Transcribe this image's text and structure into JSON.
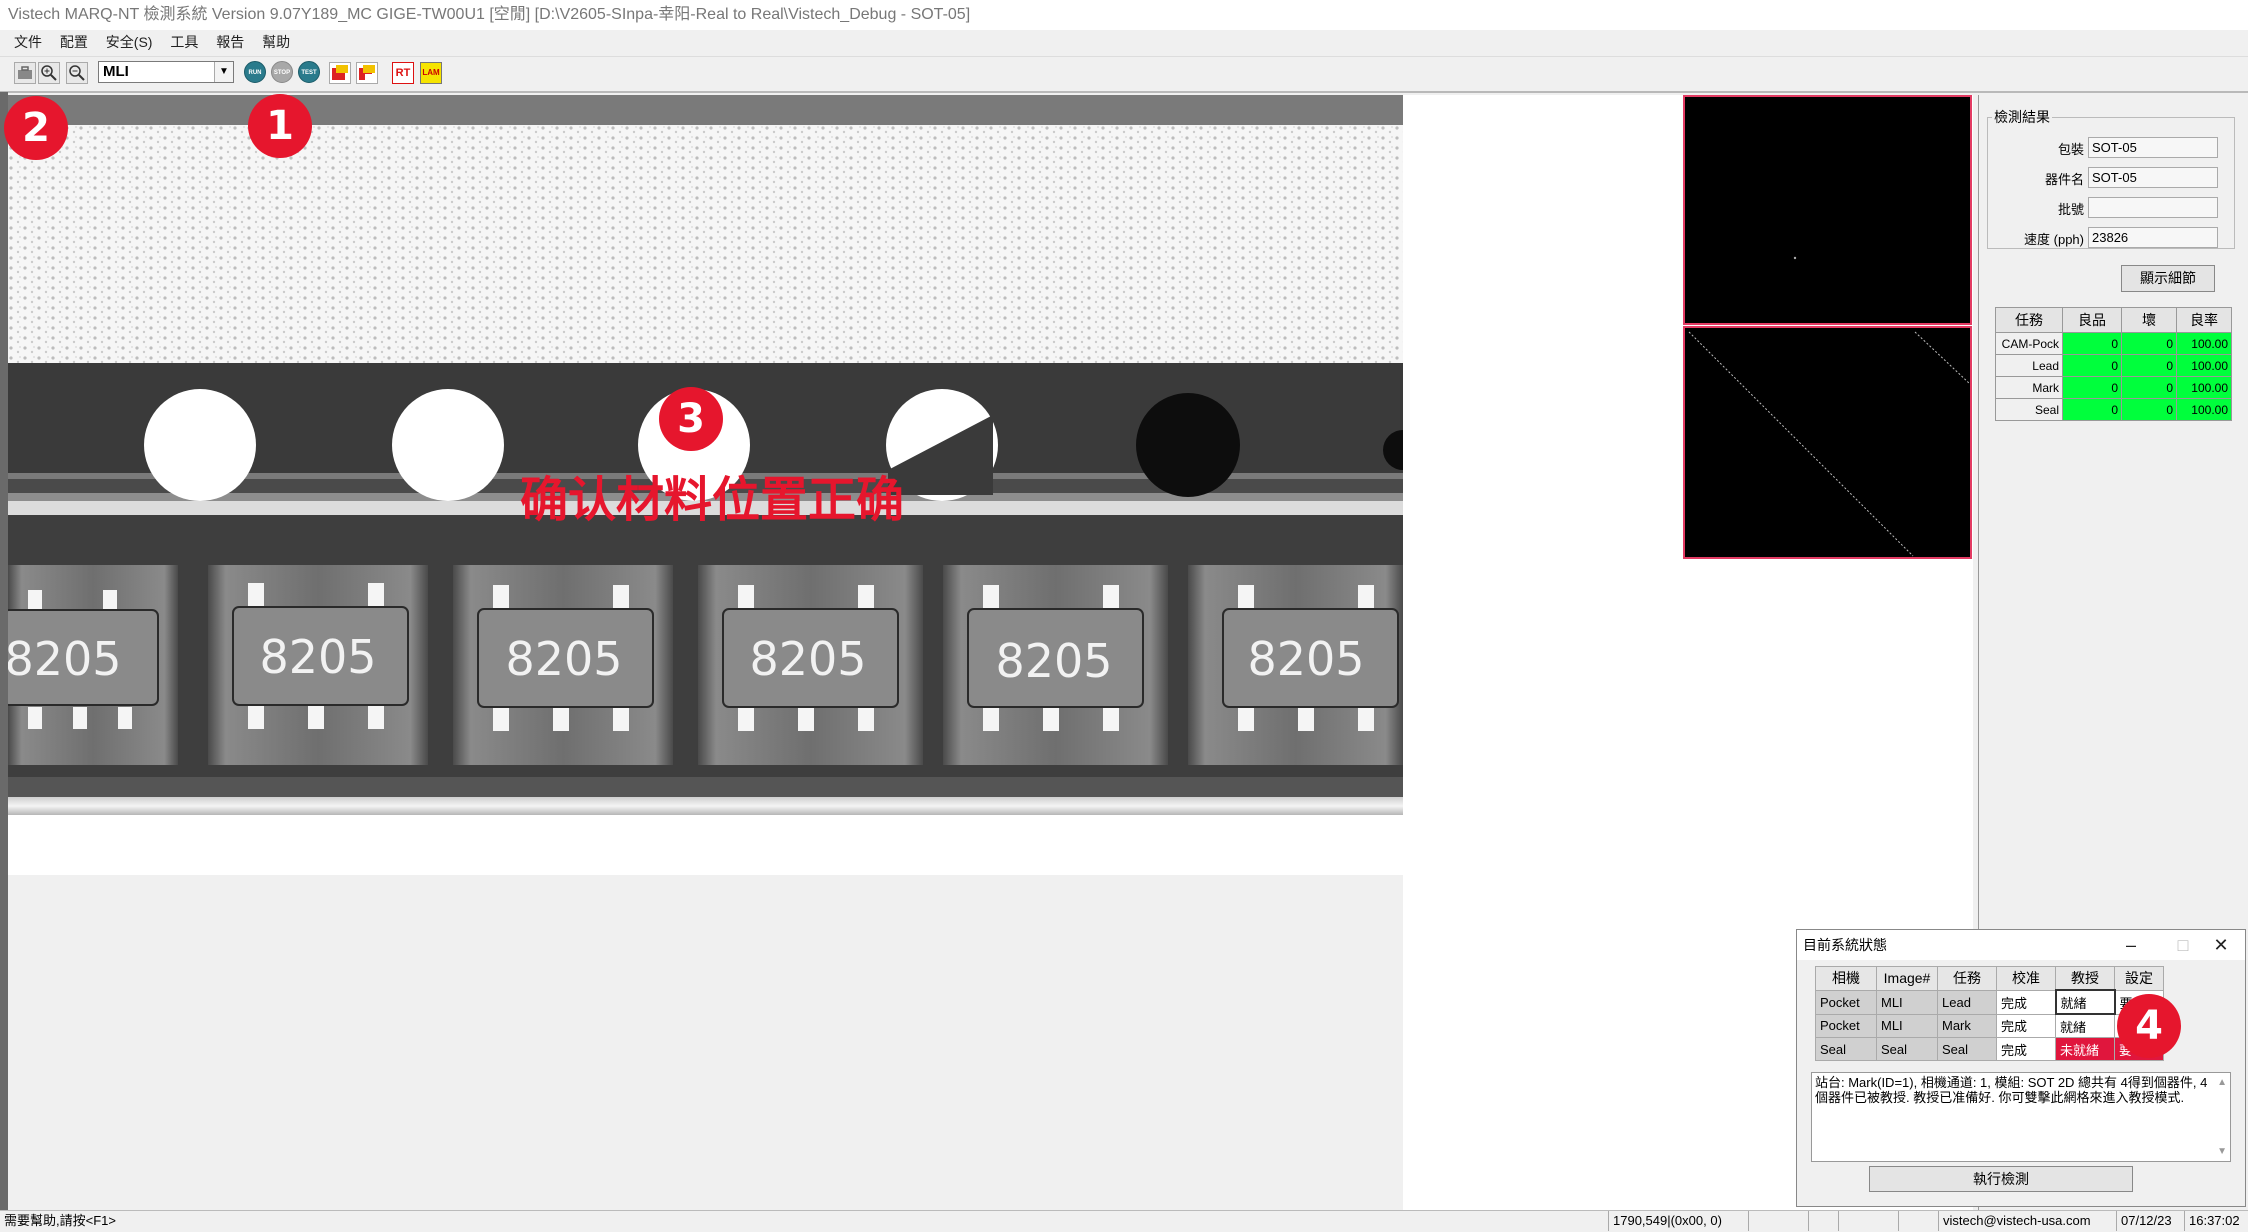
{
  "window": {
    "title": "Vistech MARQ-NT 檢測系統 Version 9.07Y189_MC GIGE-TW00U1 [空閒] [D:\\V2605-SInpa-幸阳-Real to Real\\Vistech_Debug - SOT-05]"
  },
  "menu": [
    "文件",
    "配置",
    "安全(S)",
    "工具",
    "報告",
    "幫助"
  ],
  "toolbar": {
    "camera_select": "MLI",
    "run_label": "RUN",
    "stop_label": "STOP",
    "test_label": "TEST",
    "rt_label": "RT",
    "lam_label": "LAM"
  },
  "annotations": {
    "badge1": "1",
    "badge2": "2",
    "badge3": "3",
    "badge4": "4",
    "confirm_text": "确认材料位置正确"
  },
  "component_marking": "8205",
  "results": {
    "legend": "檢測結果",
    "package_label": "包裝",
    "package_value": "SOT-05",
    "device_label": "器件名",
    "device_value": "SOT-05",
    "lot_label": "批號",
    "lot_value": "",
    "speed_label": "速度 (pph)",
    "speed_value": "23826",
    "details_button": "顯示細節"
  },
  "stats": {
    "headers": [
      "任務",
      "良品",
      "壞",
      "良率"
    ],
    "rows": [
      {
        "task": "CAM-Pock",
        "good": "0",
        "bad": "0",
        "yield": "100.00"
      },
      {
        "task": "Lead",
        "good": "0",
        "bad": "0",
        "yield": "100.00"
      },
      {
        "task": "Mark",
        "good": "0",
        "bad": "0",
        "yield": "100.00"
      },
      {
        "task": "Seal",
        "good": "0",
        "bad": "0",
        "yield": "100.00"
      }
    ]
  },
  "status_dialog": {
    "title": "目前系統狀態",
    "headers": [
      "相機",
      "Image#",
      "任務",
      "校准",
      "教授",
      "設定"
    ],
    "rows": [
      {
        "camera": "Pocket",
        "image": "MLI",
        "task": "Lead",
        "calib": "完成",
        "teach": "就緒",
        "setting": "要"
      },
      {
        "camera": "Pocket",
        "image": "MLI",
        "task": "Mark",
        "calib": "完成",
        "teach": "就緒",
        "setting": ""
      },
      {
        "camera": "Seal",
        "image": "Seal",
        "task": "Seal",
        "calib": "完成",
        "teach": "未就緒",
        "setting": "要"
      }
    ],
    "log": "站台: Mark(ID=1), 相機通道: 1, 模組: SOT 2D 總共有 4得到個器件, 4個器件已被教授. 教授已准備好. 你可雙擊此網格來進入教授模式.",
    "run_button": "執行檢測"
  },
  "statusbar": {
    "help": "需要幫助,請按<F1>",
    "coords": "1790,549|(0x00,  0)",
    "email": "vistech@vistech-usa.com",
    "date": "07/12/23",
    "time": "16:37:02"
  },
  "colors": {
    "accent_red": "#e6162d",
    "good_green": "#00ff3c",
    "thumb_border": "#e33b63"
  }
}
